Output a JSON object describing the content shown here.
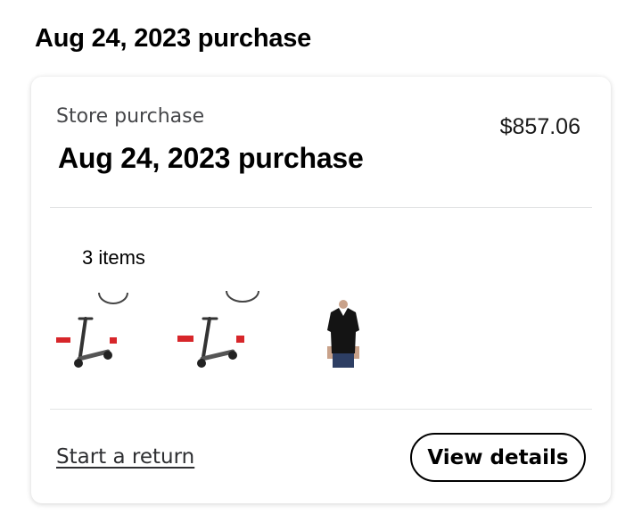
{
  "page": {
    "heading": "Aug 24, 2023 purchase"
  },
  "order": {
    "purchase_type": "Store purchase",
    "title": "Aug 24, 2023 purchase",
    "total": "$857.06",
    "item_count": "3 items",
    "items": [
      {
        "icon": "electric-scooter-thumbnail"
      },
      {
        "icon": "electric-scooter-thumbnail"
      },
      {
        "icon": "black-vneck-tshirt-thumbnail"
      }
    ],
    "actions": {
      "start_return": "Start a return",
      "view_details": "View details"
    }
  }
}
